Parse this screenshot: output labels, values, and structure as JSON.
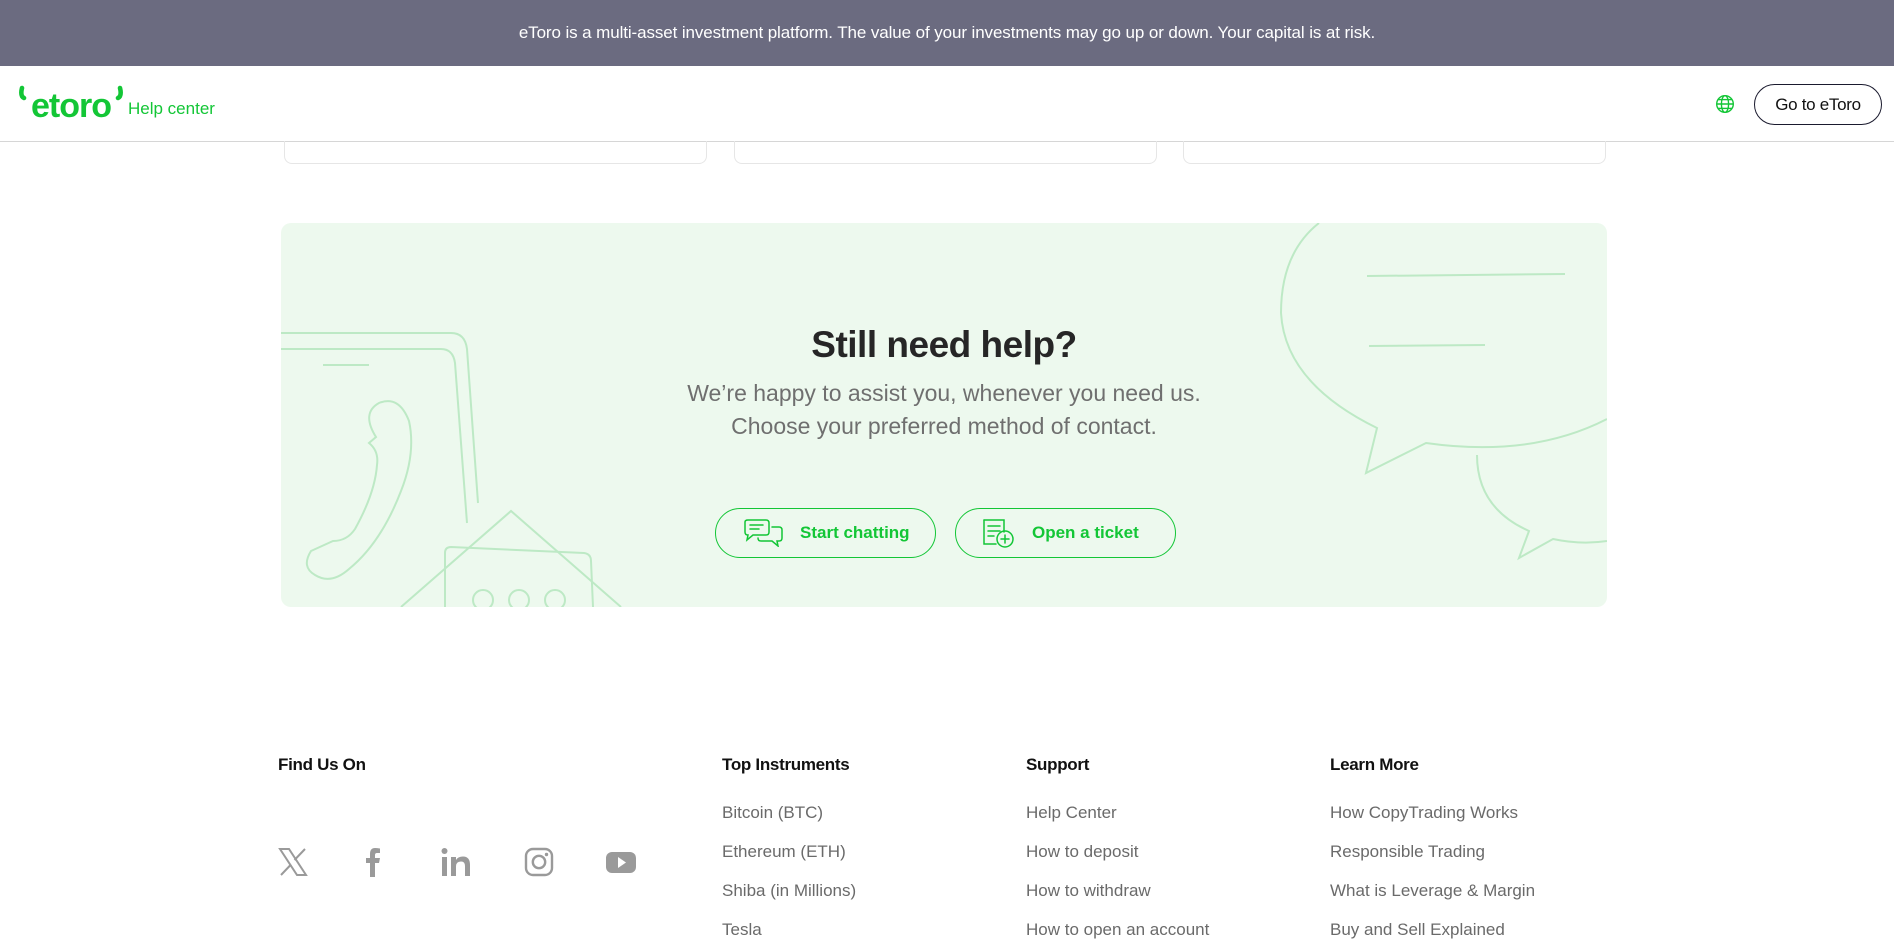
{
  "banner": {
    "text": "eToro is a multi-asset investment platform. The value of your investments may go up or down. Your capital is at risk."
  },
  "header": {
    "logo_text": "etoro",
    "logo_sub": "Help center",
    "language_icon": "globe-icon",
    "cta_label": "Go to eToro"
  },
  "help": {
    "title": "Still need help?",
    "subtitle_line1": "We’re happy to assist you, whenever you need us.",
    "subtitle_line2": "Choose your preferred method of contact.",
    "chat_label": "Start chatting",
    "chat_icon": "chat-bubbles-icon",
    "ticket_label": "Open a ticket",
    "ticket_icon": "ticket-plus-icon"
  },
  "footer": {
    "find_us": {
      "heading": "Find Us On",
      "icons": [
        "x-twitter-icon",
        "facebook-icon",
        "linkedin-icon",
        "instagram-icon",
        "youtube-icon"
      ]
    },
    "columns": [
      {
        "heading": "Top Instruments",
        "items": [
          "Bitcoin (BTC)",
          "Ethereum (ETH)",
          "Shiba (in Millions)",
          "Tesla"
        ]
      },
      {
        "heading": "Support",
        "items": [
          "Help Center",
          "How to deposit",
          "How to withdraw",
          "How to open an account"
        ]
      },
      {
        "heading": "Learn More",
        "items": [
          "How CopyTrading Works",
          "Responsible Trading",
          "What is Leverage & Margin",
          "Buy and Sell Explained"
        ]
      }
    ]
  },
  "colors": {
    "brand_green": "#13c636",
    "banner_bg": "#6b6b80",
    "panel_bg": "#edf9ee"
  }
}
